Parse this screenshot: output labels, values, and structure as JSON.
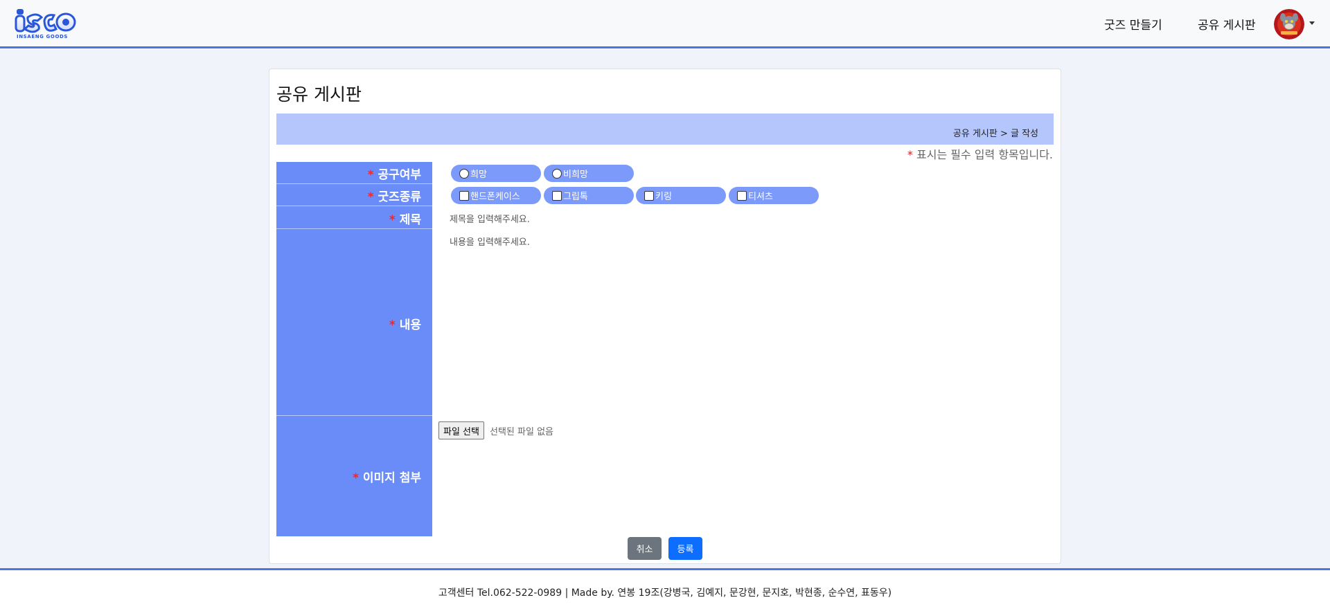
{
  "header": {
    "logo_text": "isgo",
    "logo_subtitle": "INSAENG GOODS",
    "nav": {
      "make_goods": "굿즈 만들기",
      "share_board": "공유 게시판"
    },
    "avatar_icon": "user-avatar-icon"
  },
  "page": {
    "title": "공유 게시판",
    "breadcrumb": "공유 게시판 > 글 작성",
    "required_star": "*",
    "required_note": "표시는 필수 입력 항목입니다."
  },
  "form": {
    "gonggu": {
      "label": "공구여부",
      "options": [
        "희망",
        "비희망"
      ]
    },
    "goods_type": {
      "label": "굿즈종류",
      "options": [
        "핸드폰케이스",
        "그립톡",
        "키링",
        "티셔츠"
      ]
    },
    "title": {
      "label": "제목",
      "placeholder": "제목을 입력해주세요."
    },
    "content": {
      "label": "내용",
      "placeholder": "내용을 입력해주세요."
    },
    "image": {
      "label": "이미지 첨부",
      "file_button": "파일 선택",
      "file_status": "선택된 파일 없음"
    },
    "buttons": {
      "cancel": "취소",
      "submit": "등록"
    }
  },
  "colors": {
    "accent": "#4f74de",
    "label_bg": "#6a8cf8",
    "pill_bg": "#7c9af9",
    "breadcrumb_bg": "#b4c6fb",
    "submit": "#0d6efd",
    "cancel": "#6c757d",
    "required": "#ee1111"
  },
  "footer": {
    "text": "고객센터 Tel.062-522-0989 | Made by. 연봉 19조(강병국, 김예지, 문강현, 문지호, 박현종, 순수연, 표동우)"
  }
}
